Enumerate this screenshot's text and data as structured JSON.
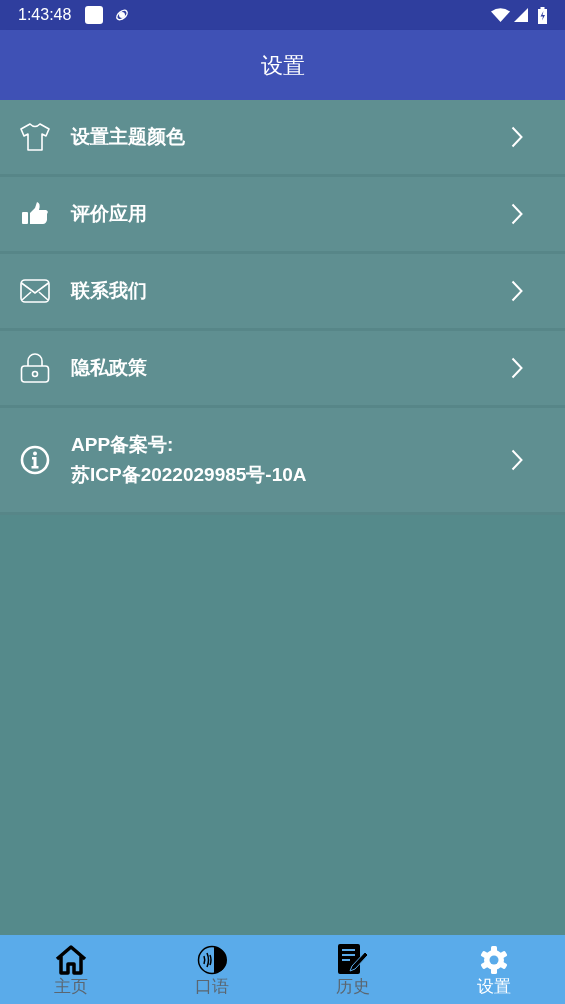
{
  "status_bar": {
    "time": "1:43:48"
  },
  "app_bar": {
    "title": "设置"
  },
  "settings": [
    {
      "kind": "shirt",
      "lines": [
        "设置主题颜色"
      ]
    },
    {
      "kind": "thumb",
      "lines": [
        "评价应用"
      ]
    },
    {
      "kind": "mail",
      "lines": [
        "联系我们"
      ]
    },
    {
      "kind": "lock",
      "lines": [
        "隐私政策"
      ]
    },
    {
      "kind": "info",
      "lines": [
        "APP备案号:",
        "苏ICP备2022029985号-10A"
      ]
    }
  ],
  "bottom_nav": [
    {
      "kind": "home",
      "label": "主页",
      "selected": false
    },
    {
      "kind": "speech",
      "label": "口语",
      "selected": false
    },
    {
      "kind": "history",
      "label": "历史",
      "selected": false
    },
    {
      "kind": "settings",
      "label": "设置",
      "selected": true
    }
  ]
}
